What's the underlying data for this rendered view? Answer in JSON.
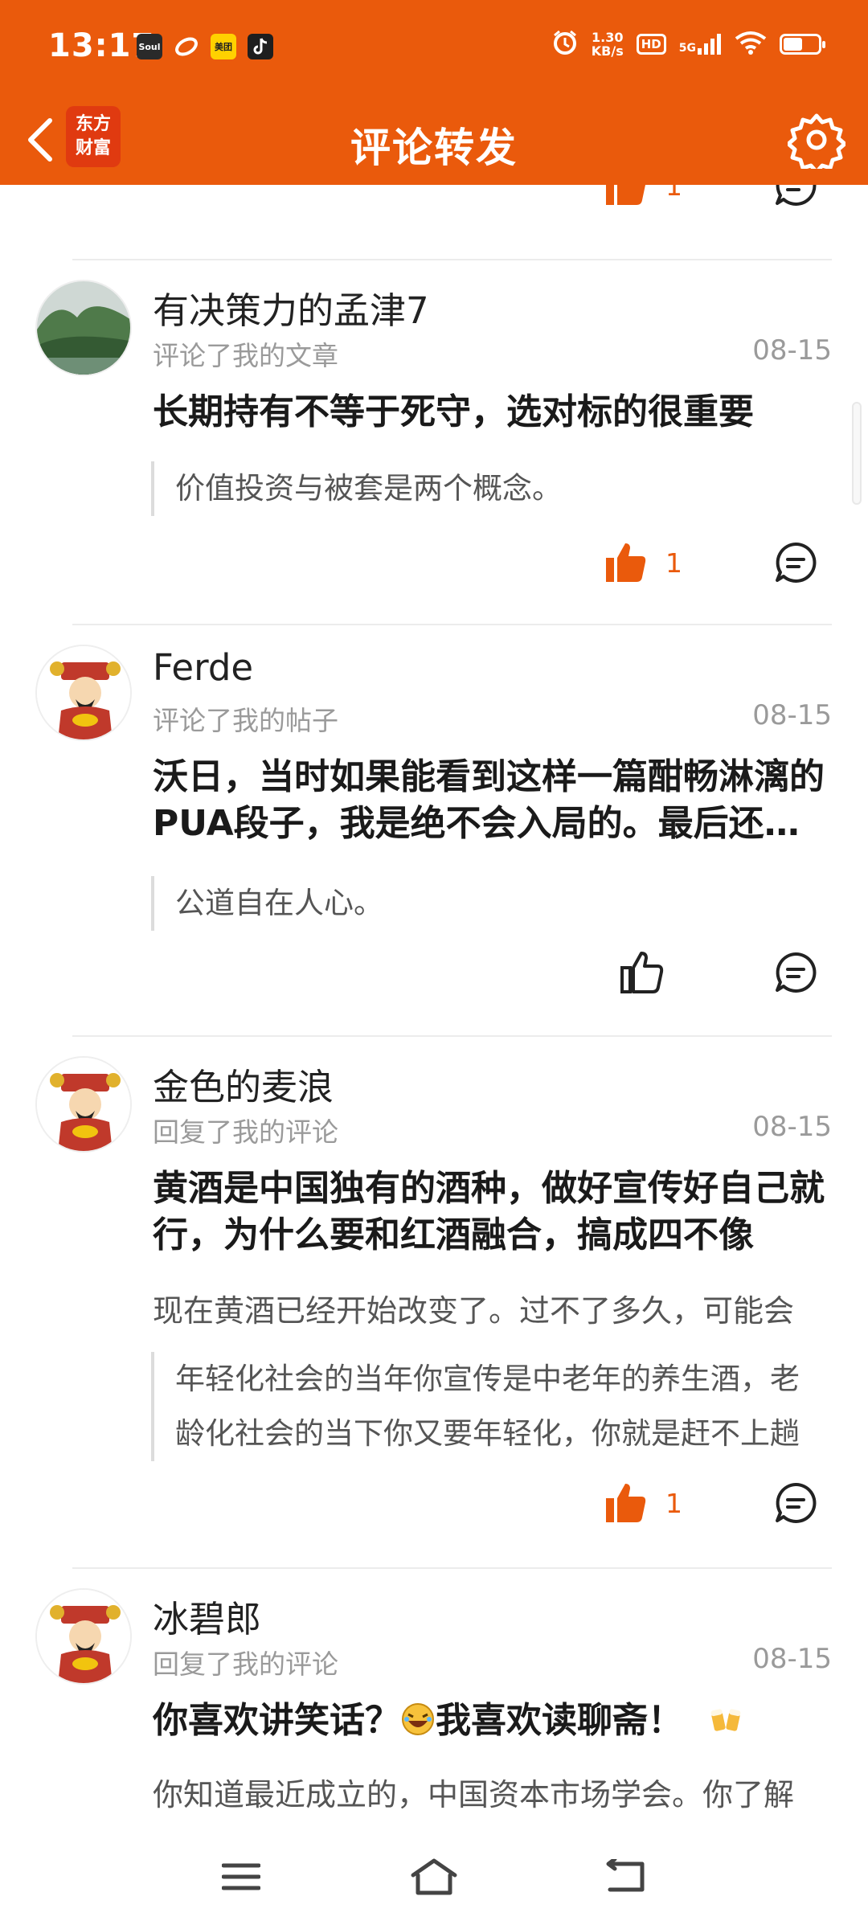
{
  "status_bar": {
    "time": "13:17",
    "net_speed_value": "1.30",
    "net_speed_unit": "KB/s",
    "hd": "HD",
    "signal": "5G",
    "battery_level": 0.55,
    "notification_icons": [
      "soul-app-icon",
      "swirl-app-icon",
      "meituan-app-icon",
      "tiktok-app-icon"
    ]
  },
  "header": {
    "logo_line1": "东方",
    "logo_line2": "财富",
    "title": "评论转发",
    "brand_color": "#ea5a0c"
  },
  "top_partial": {
    "like_count": "1"
  },
  "items": [
    {
      "username": "有决策力的孟津7",
      "action": "评论了我的文章",
      "date": "08-15",
      "content": "长期持有不等于死守，选对标的很重要",
      "quote": "价值投资与被套是两个概念。",
      "liked": true,
      "like_count": "1"
    },
    {
      "username": "Ferde",
      "action": "评论了我的帖子",
      "date": "08-15",
      "content": "沃日，当时如果能看到这样一篇酣畅淋漓的PUA段子，我是绝不会入局的。最后还不是被割了",
      "quote": "公道自在人心。",
      "liked": false,
      "like_count": ""
    },
    {
      "username": "金色的麦浪",
      "action": "回复了我的评论",
      "date": "08-15",
      "content": "黄酒是中国独有的酒种，做好宣传好自己就行，为什么要和红酒融合，搞成四不像",
      "reply": "现在黄酒已经开始改变了。过不了多久，可能会",
      "quote": "年轻化社会的当年你宣传是中老年的养生酒，老龄化社会的当下你又要年轻化，你就是赶不上趟",
      "liked": true,
      "like_count": "1"
    },
    {
      "username": "冰碧郎",
      "action": "回复了我的评论",
      "date": "08-15",
      "content_a": "你喜欢讲笑话？",
      "content_b": "我喜欢读聊斋！",
      "reply": "你知道最近成立的，中国资本市场学会。你了解"
    }
  ]
}
